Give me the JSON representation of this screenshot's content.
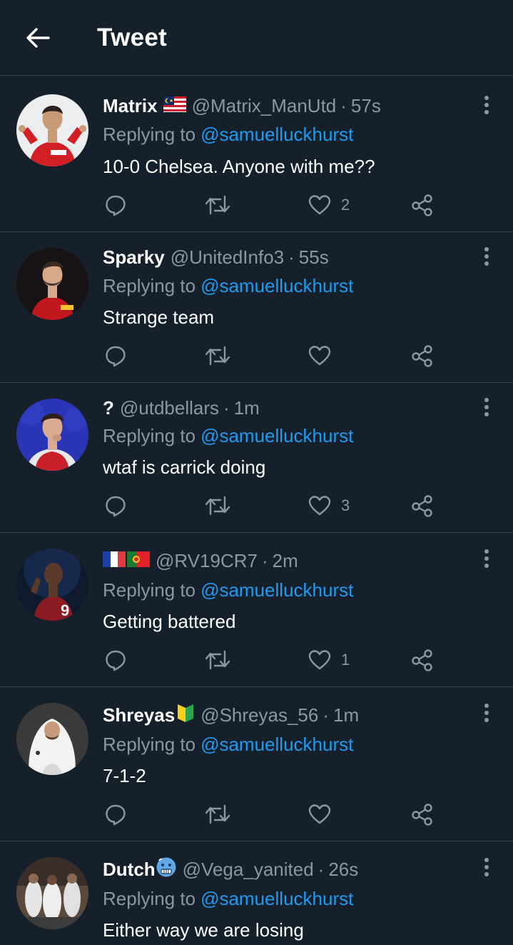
{
  "header": {
    "title": "Tweet",
    "back_icon": "arrow-left-icon"
  },
  "colors": {
    "background": "#15202b",
    "divider": "#38444d",
    "secondary_text": "#8899a6",
    "link": "#1d9bf0",
    "primary_text": "#ffffff"
  },
  "replying_to_label": "Replying to",
  "tweets": [
    {
      "name": "Matrix",
      "name_emoji": "malaysia-flag",
      "handle": "@Matrix_ManUtd",
      "time": "57s",
      "replying_to": "@samuelluckhurst",
      "text": "10-0 Chelsea. Anyone with me??",
      "likes": "2"
    },
    {
      "name": "Sparky",
      "handle": "@UnitedInfo3",
      "time": "55s",
      "replying_to": "@samuelluckhurst",
      "text": "Strange team",
      "likes": ""
    },
    {
      "name": "?",
      "handle": "@utdbellars",
      "time": "1m",
      "replying_to": "@samuelluckhurst",
      "text": "wtaf is carrick doing",
      "likes": "3"
    },
    {
      "name": "",
      "name_emoji": "france-flag portugal-flag",
      "handle": "@RV19CR7",
      "time": "2m",
      "replying_to": "@samuelluckhurst",
      "text": "Getting battered",
      "likes": "1"
    },
    {
      "name": "Shreyas",
      "name_emoji": "beginner-badge",
      "handle": "@Shreyas_56",
      "time": "1m",
      "replying_to": "@samuelluckhurst",
      "text": "7-1-2",
      "likes": ""
    },
    {
      "name": "Dutch",
      "name_emoji": "cold-face",
      "handle": "@Vega_yanited",
      "time": "26s",
      "replying_to": "@samuelluckhurst",
      "text": "Either way we are losing",
      "likes": ""
    }
  ],
  "separator": "·"
}
